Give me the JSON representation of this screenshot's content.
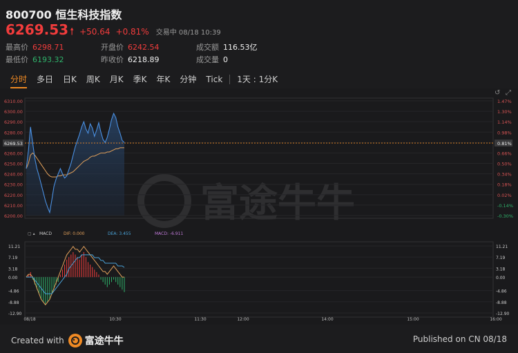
{
  "header": {
    "title": "800700 恒生科技指数",
    "price": "6269.53",
    "change": "+50.64",
    "change_pct": "+0.81%",
    "status": "交易中  08/18 10:39",
    "stats": {
      "high_label": "最高价",
      "high": "6298.71",
      "low_label": "最低价",
      "low": "6193.32",
      "open_label": "开盘价",
      "open": "6242.54",
      "prev_close_label": "昨收价",
      "prev_close": "6218.89",
      "turnover_label": "成交额",
      "turnover": "116.53亿",
      "volume_label": "成交量",
      "volume": "0"
    }
  },
  "tabs": {
    "items": [
      "分时",
      "多日",
      "日K",
      "周K",
      "月K",
      "季K",
      "年K",
      "分钟",
      "Tick"
    ],
    "active": "分时",
    "extra": "1天 : 1分K"
  },
  "chart_data": [
    {
      "type": "line",
      "title": "",
      "xlabel": "",
      "ylabel": "",
      "ylim": [
        6200,
        6310
      ],
      "y_ticks_left": [
        "6310.00",
        "6300.00",
        "6290.00",
        "6280.00",
        "6270.00",
        "6260.00",
        "6250.00",
        "6240.00",
        "6230.00",
        "6220.00",
        "6210.00",
        "6200.00"
      ],
      "y_ticks_right": [
        "1.47%",
        "1.30%",
        "1.14%",
        "0.98%",
        "0.81%",
        "0.66%",
        "0.50%",
        "0.34%",
        "0.18%",
        "0.02%",
        "-0.14%",
        "-0.30%"
      ],
      "current_price_label": "6269.53",
      "current_pct_label": "0.81%",
      "x_ticks": [
        "08/18",
        "10:30",
        "11:30",
        "12:00",
        "14:00",
        "15:00",
        "16:00"
      ],
      "series": [
        {
          "values": [
            6245,
            6262,
            6285,
            6270,
            6255,
            6245,
            6238,
            6230,
            6222,
            6214,
            6208,
            6203,
            6215,
            6228,
            6235,
            6240,
            6245,
            6240,
            6236,
            6238,
            6244,
            6250,
            6258,
            6266,
            6272,
            6278,
            6285,
            6290,
            6283,
            6279,
            6288,
            6284,
            6276,
            6282,
            6289,
            6280,
            6273,
            6270,
            6275,
            6283,
            6292,
            6298,
            6294,
            6285,
            6279,
            6272,
            6270
          ]
        },
        {
          "values": [
            6245,
            6250,
            6258,
            6260,
            6258,
            6255,
            6252,
            6249,
            6246,
            6243,
            6240,
            6238,
            6237,
            6237,
            6237,
            6238,
            6238,
            6239,
            6239,
            6239,
            6240,
            6241,
            6242,
            6244,
            6246,
            6248,
            6250,
            6252,
            6253,
            6254,
            6256,
            6257,
            6257,
            6258,
            6259,
            6260,
            6260,
            6260,
            6261,
            6261,
            6262,
            6263,
            6264,
            6264,
            6265,
            6265,
            6265
          ]
        }
      ]
    },
    {
      "type": "bar",
      "title": "MACD",
      "indicator": {
        "dif_label": "DIF:",
        "dif": "0.000",
        "dea_label": "DEA:",
        "dea": "3.455",
        "macd_label": "MACD:",
        "macd": "-6.911"
      },
      "ylim": [
        -12.9,
        11.21
      ],
      "y_ticks": [
        "11.21",
        "7.19",
        "3.18",
        "0.00",
        "-4.86",
        "-8.88",
        "-12.90"
      ],
      "histogram": [
        0,
        1,
        2,
        -1,
        -3,
        -5,
        -7,
        -9,
        -10,
        -11,
        -10,
        -9,
        -7,
        -5,
        -3,
        -2,
        1,
        3,
        5,
        7,
        8,
        9,
        10,
        9,
        8,
        7,
        9,
        10,
        8,
        6,
        5,
        4,
        3,
        2,
        1,
        -1,
        -2,
        -3,
        -4,
        -3,
        -2,
        -1,
        -2,
        -3,
        -4,
        -5,
        -6
      ],
      "series": [
        {
          "name": "DIF",
          "values": [
            0,
            1,
            1,
            0,
            -2,
            -4,
            -6,
            -8,
            -9,
            -10,
            -9,
            -8,
            -6,
            -4,
            -2,
            0,
            2,
            4,
            6,
            8,
            9,
            10,
            11,
            10,
            10,
            9,
            10,
            11,
            10,
            9,
            8,
            7,
            6,
            5,
            4,
            3,
            2,
            2,
            1,
            2,
            3,
            4,
            3,
            2,
            1,
            0,
            0
          ]
        },
        {
          "name": "DEA",
          "values": [
            0,
            0,
            0,
            0,
            -1,
            -2,
            -3,
            -4,
            -5,
            -6,
            -6,
            -6,
            -6,
            -5,
            -4,
            -3,
            -2,
            -1,
            0,
            1,
            3,
            4,
            5,
            6,
            7,
            7,
            8,
            8,
            8,
            8,
            8,
            8,
            7,
            7,
            7,
            6,
            6,
            5,
            5,
            5,
            5,
            5,
            5,
            4,
            4,
            4,
            3.5
          ]
        }
      ]
    }
  ],
  "footer": {
    "created_with": "Created with",
    "brand": "富途牛牛",
    "published": "Published on CN 08/18"
  },
  "watermark": "富途牛牛",
  "colors": {
    "up": "#f23c3c",
    "down": "#2fb36b",
    "accent": "#f08a24",
    "price_line": "#4a90e2",
    "avg_line": "#e3a15b"
  }
}
